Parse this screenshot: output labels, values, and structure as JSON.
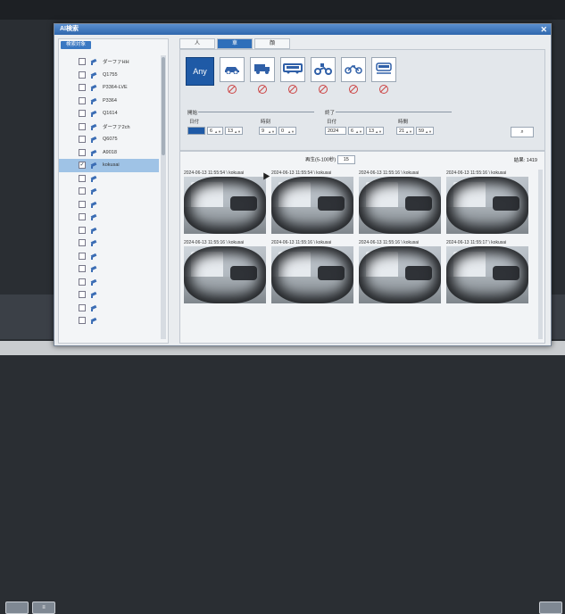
{
  "outer": {
    "left_buttons": [
      "",
      "≡"
    ],
    "right_button": ""
  },
  "window": {
    "title": "AI検索",
    "close": "✕"
  },
  "sidebar": {
    "tab": "検索対象",
    "cameras": [
      {
        "label": "ダーファHH",
        "checked": false
      },
      {
        "label": "Q1755",
        "checked": false
      },
      {
        "label": "P3364-LVE",
        "checked": false
      },
      {
        "label": "P3364",
        "checked": false
      },
      {
        "label": "Q1614",
        "checked": false
      },
      {
        "label": "ダーファ2ch",
        "checked": false
      },
      {
        "label": "Q6075",
        "checked": false
      },
      {
        "label": "A9018",
        "checked": false
      },
      {
        "label": "kokusai",
        "checked": true
      },
      {
        "label": "",
        "checked": false
      },
      {
        "label": "",
        "checked": false
      },
      {
        "label": "",
        "checked": false
      },
      {
        "label": "",
        "checked": false
      },
      {
        "label": "",
        "checked": false
      },
      {
        "label": "",
        "checked": false
      },
      {
        "label": "",
        "checked": false
      },
      {
        "label": "",
        "checked": false
      },
      {
        "label": "",
        "checked": false
      },
      {
        "label": "",
        "checked": false
      },
      {
        "label": "",
        "checked": false
      },
      {
        "label": "",
        "checked": false
      }
    ]
  },
  "tabs": [
    "人",
    "車",
    "顔"
  ],
  "active_tab": 1,
  "filters": {
    "types": [
      "Any",
      "car-icon",
      "truck-icon",
      "bus-icon",
      "motorcycle-icon",
      "bicycle-icon",
      "tram-icon"
    ],
    "start": {
      "group": "開始",
      "date_label": "日付",
      "time_label": "時刻",
      "year": "",
      "month": "6",
      "day": "13",
      "hour": "9",
      "minute": "0"
    },
    "end": {
      "group": "終了",
      "date_label": "日付",
      "time_label": "時間",
      "year": "2024",
      "month": "6",
      "day": "13",
      "hour": "21",
      "minute": "59"
    },
    "search_icon": "⌕"
  },
  "results": {
    "pager_label": "再生(5-100秒)",
    "pager_value": "15",
    "count_label": "結果: 1419",
    "items": [
      {
        "caption": "2024-06-13 11:55:54 \\ kokusai"
      },
      {
        "caption": "2024-06-13 11:55:54 \\ kokusai"
      },
      {
        "caption": "2024-06-13 11:55:16 \\ kokusai"
      },
      {
        "caption": "2024-06-13 11:55:16 \\ kokusai"
      },
      {
        "caption": "2024-06-13 11:55:16 \\ kokusai"
      },
      {
        "caption": "2024-06-13 11:55:16 \\ kokusai"
      },
      {
        "caption": "2024-06-13 11:55:16 \\ kokusai"
      },
      {
        "caption": "2024-06-13 11:55:17 \\ kokusai"
      }
    ]
  }
}
